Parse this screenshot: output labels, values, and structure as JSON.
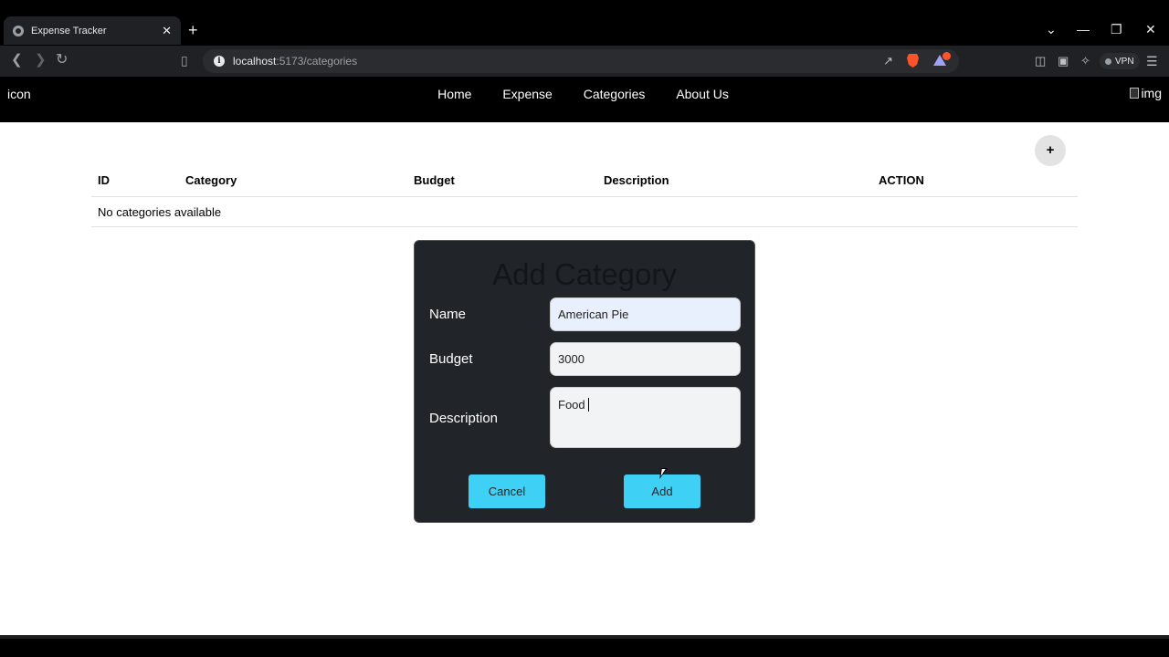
{
  "browser": {
    "tab_title": "Expense Tracker",
    "tab_close": "✕",
    "new_tab": "+",
    "url_host": "localhost",
    "url_path": ":5173/categories",
    "vpn_label": "VPN",
    "window_controls": [
      "⌄",
      "—",
      "❐",
      "✕"
    ]
  },
  "appnav": {
    "brand": "icon",
    "links": [
      "Home",
      "Expense",
      "Categories",
      "About Us"
    ],
    "profile_alt": "img"
  },
  "fab_label": "+",
  "table": {
    "headers": [
      "ID",
      "Category",
      "Budget",
      "Description",
      "ACTION"
    ],
    "empty_message": "No categories available"
  },
  "modal": {
    "title": "Add Category",
    "name_label": "Name",
    "name_value": "American Pie",
    "budget_label": "Budget",
    "budget_value": "3000",
    "description_label": "Description",
    "description_value": "Food",
    "cancel_label": "Cancel",
    "add_label": "Add"
  },
  "colors": {
    "accent_button": "#3fd1f5",
    "modal_bg": "#212529",
    "nav_bg": "#000000"
  }
}
